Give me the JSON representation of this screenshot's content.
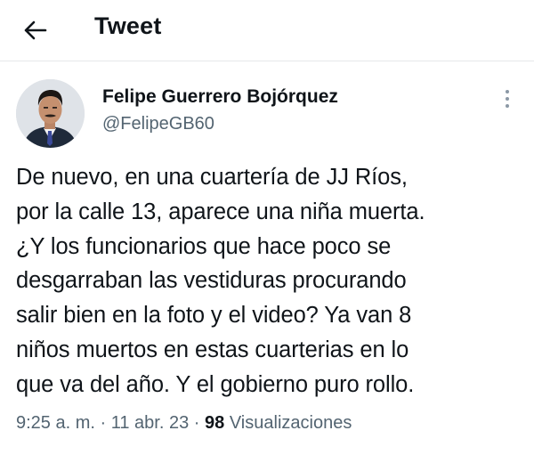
{
  "header": {
    "title": "Tweet",
    "back_icon": "arrow-left-icon"
  },
  "tweet": {
    "author": {
      "display_name": "Felipe Guerrero Bojórquez",
      "handle": "@FelipeGB60",
      "avatar": "profile-photo"
    },
    "more_icon": "vertical-ellipsis-icon",
    "text": "De nuevo, en una cuartería de JJ Ríos,\npor la calle 13, aparece una niña muerta.\n¿Y los funcionarios que hace poco se\ndesgarraban las vestiduras procurando\nsalir bien en la foto y el video? Ya van 8\nniños muertos en estas cuarterias en lo\nque va del año. Y el gobierno puro rollo.",
    "time": "9:25 a. m.",
    "separator": "·",
    "date": "11 abr. 23",
    "views_count": "98",
    "views_label": "Visualizaciones"
  },
  "colors": {
    "text_primary": "#0f1419",
    "text_secondary": "#536471",
    "divider": "#e6e8ea",
    "background": "#ffffff"
  }
}
